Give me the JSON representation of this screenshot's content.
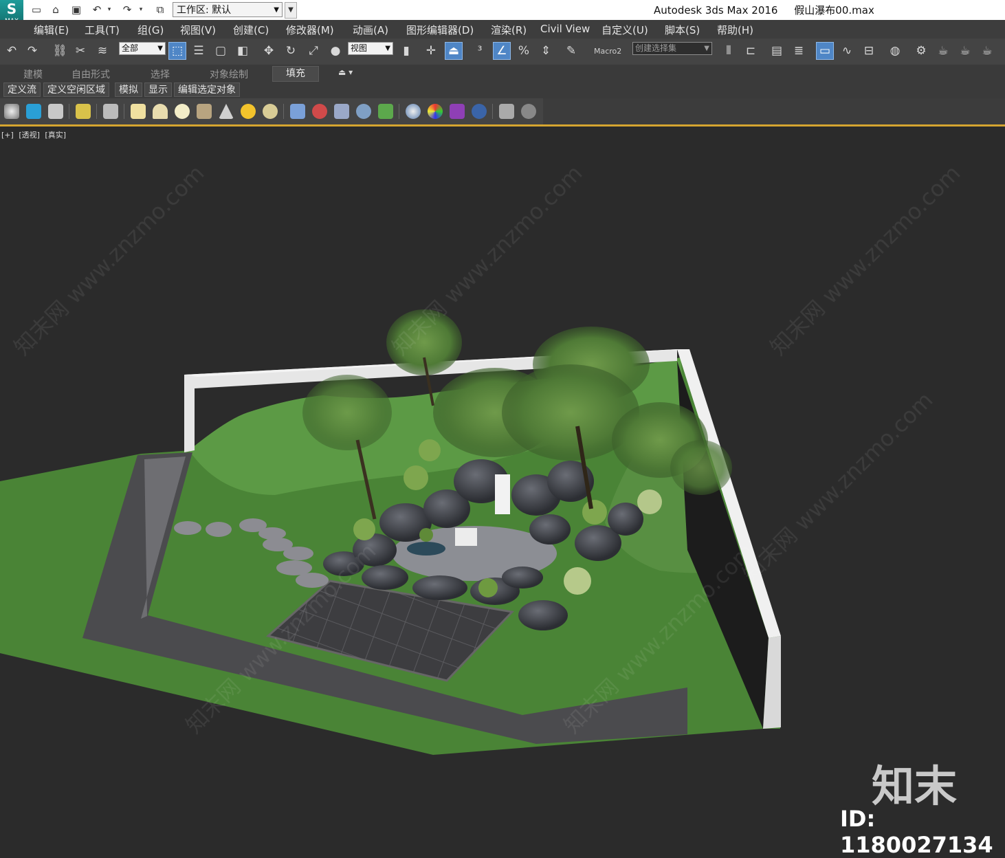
{
  "titlebar": {
    "app_name": "Autodesk 3ds Max 2016",
    "file_name": "假山瀑布00.max",
    "logo_text": "MAX",
    "workspace_label": "工作区: 默认"
  },
  "menu": [
    "编辑(E)",
    "工具(T)",
    "组(G)",
    "视图(V)",
    "创建(C)",
    "修改器(M)",
    "动画(A)",
    "图形编辑器(D)",
    "渲染(R)",
    "Civil View",
    "自定义(U)",
    "脚本(S)",
    "帮助(H)"
  ],
  "toolbar": {
    "selection_filter": "全部",
    "reference_coord": "视图",
    "macro_label": "Macro2",
    "named_selection_placeholder": "创建选择集"
  },
  "ribbon_tabs": [
    "建模",
    "自由形式",
    "选择",
    "对象绘制",
    "填充"
  ],
  "ribbon_active": "填充",
  "sub_tabs": [
    "定义流",
    "定义空闲区域",
    "模拟",
    "显示",
    "编辑选定对象"
  ],
  "viewport": {
    "labels": [
      "[+]",
      "[透视]",
      "[真实]"
    ]
  },
  "watermark_text": "知末网 www.znzmo.com",
  "brand": {
    "logo_text": "知末",
    "id_text": "ID: 1180027134"
  },
  "colors": {
    "accent": "#d5a530",
    "active_tool": "#4f86c6",
    "grass": "#4f8a3a",
    "wall": "#e6e6e6"
  }
}
